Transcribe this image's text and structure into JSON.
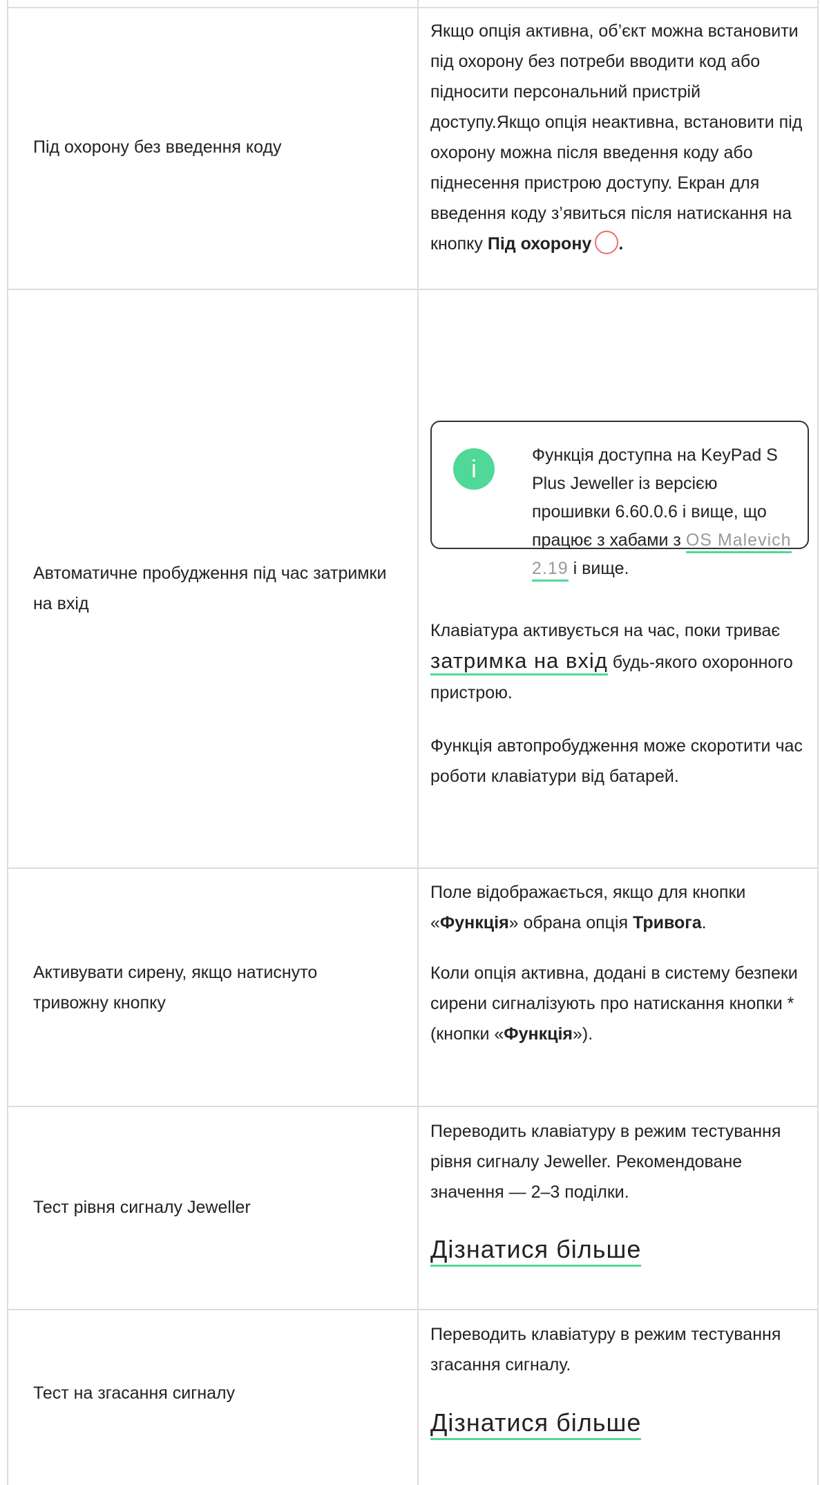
{
  "rows": [
    {
      "label": "Під охорону без введення коду",
      "desc_part1": "Якщо опція активна, об’єкт можна встановити під охорону без потреби вводити код або підносити персональний пристрій доступу.Якщо опція неактивна, встановити під охорону можна після введення коду або піднесення пристрою доступу. Екран для введення коду з’явиться після натискання на кнопку ",
      "desc_bold": "Під охорону",
      "desc_end": ".",
      "icon": "arm-circle-icon",
      "icon_color": "#f06a6a"
    },
    {
      "label": "Автоматичне пробудження під час затримки на вхід",
      "note": {
        "icon": "info-icon",
        "text_before": "Функція доступна на KeyPad S Plus Jeweller із версією прошивки 6.60.0.6 і вище, що працює з хабами з ",
        "link": "OS Malevich 2.19",
        "text_after": " і вище."
      },
      "para1_before": "Клавіатура активується на час, поки триває ",
      "para1_link": "затримка на вхід",
      "para1_after": " будь-якого охоронного пристрою.",
      "para2": "Функція автопробудження може скоротити час роботи клавіатури від батарей."
    },
    {
      "label": "Активувати сирену, якщо натиснуто тривожну кнопку",
      "para1_a": "Поле відображається, якщо для кнопки «",
      "para1_b": "Функція",
      "para1_c": "» обрана опція ",
      "para1_d": "Тривога",
      "para1_e": ".",
      "para2_a": "Коли опція активна, додані в систему безпеки сирени сигналізують про натискання кнопки * (кнопки «",
      "para2_b": "Функція",
      "para2_c": "»)."
    },
    {
      "label": "Тест рівня сигналу Jeweller",
      "desc": "Переводить клавіатуру в режим тестування рівня сигналу Jeweller. Рекомендоване значення — 2–3 поділки.",
      "link": "Дізнатися більше"
    },
    {
      "label": "Тест на згасання сигналу",
      "desc": "Переводить клавіатуру в режим тестування згасання сигналу.",
      "link": "Дізнатися більше"
    }
  ],
  "colors": {
    "accent": "#4fd897",
    "arm_icon": "#f06a6a",
    "link_text": "#9a9a9a"
  }
}
